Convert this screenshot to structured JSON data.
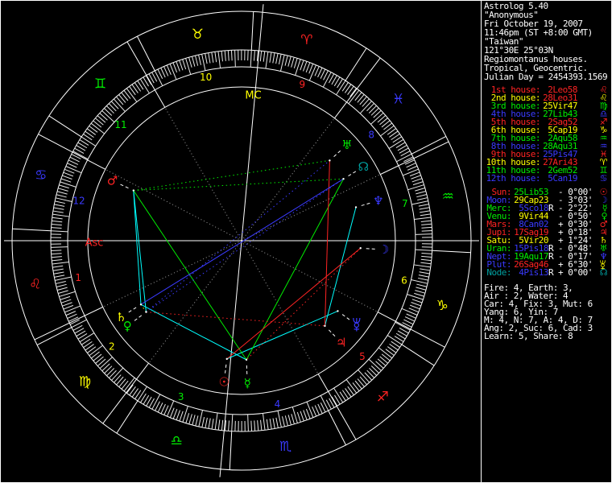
{
  "palette": {
    "red": "#ff2323",
    "yellow": "#ffff00",
    "green": "#00ee00",
    "blue": "#3a3aff",
    "cyan": "#00ffff",
    "dkcyan": "#00a0a0",
    "white": "#ffffff",
    "grey": "#9e9e9e"
  },
  "header": {
    "lines": [
      "Astrolog 5.40",
      "\"Anonymous\"",
      "Fri October 19, 2007",
      "11:46pm (ST +8:00 GMT)",
      "\"Taiwan\"",
      "121°30E 25°03N",
      "Regiomontanus houses.",
      "Tropical, Geocentric.",
      "Julian Day = 2454393.1569"
    ]
  },
  "houses": [
    {
      "label": "1st house:",
      "value": "2Leo58",
      "sign_glyph": "♌",
      "label_color": "red",
      "value_color": "red",
      "glyph_color": "red",
      "cusp": 122.967
    },
    {
      "label": "2nd house:",
      "value": "28Leo31",
      "sign_glyph": "♌",
      "label_color": "yellow",
      "value_color": "red",
      "glyph_color": "yellow",
      "cusp": 148.517
    },
    {
      "label": "3rd house:",
      "value": "25Vir47",
      "sign_glyph": "♍",
      "label_color": "green",
      "value_color": "yellow",
      "glyph_color": "green",
      "cusp": 175.783
    },
    {
      "label": "4th house:",
      "value": "27Lib43",
      "sign_glyph": "♎",
      "label_color": "blue",
      "value_color": "green",
      "glyph_color": "blue",
      "cusp": 207.717
    },
    {
      "label": "5th house:",
      "value": "2Sag52",
      "sign_glyph": "♐",
      "label_color": "red",
      "value_color": "red",
      "glyph_color": "red",
      "cusp": 242.867
    },
    {
      "label": "6th house:",
      "value": "5Cap19",
      "sign_glyph": "♑",
      "label_color": "yellow",
      "value_color": "yellow",
      "glyph_color": "yellow",
      "cusp": 275.317
    },
    {
      "label": "7th house:",
      "value": "2Aqu58",
      "sign_glyph": "♒",
      "label_color": "green",
      "value_color": "green",
      "glyph_color": "green",
      "cusp": 302.967
    },
    {
      "label": "8th house:",
      "value": "28Aqu31",
      "sign_glyph": "♒",
      "label_color": "blue",
      "value_color": "green",
      "glyph_color": "blue",
      "cusp": 328.517
    },
    {
      "label": "9th house:",
      "value": "25Pis47",
      "sign_glyph": "♓",
      "label_color": "red",
      "value_color": "blue",
      "glyph_color": "red",
      "cusp": 355.783
    },
    {
      "label": "10th house:",
      "value": "27Ari43",
      "sign_glyph": "♈",
      "label_color": "yellow",
      "value_color": "red",
      "glyph_color": "yellow",
      "cusp": 27.717
    },
    {
      "label": "11th house:",
      "value": "2Gem52",
      "sign_glyph": "♊",
      "label_color": "green",
      "value_color": "green",
      "glyph_color": "green",
      "cusp": 62.867
    },
    {
      "label": "12th house:",
      "value": "5Can19",
      "sign_glyph": "♋",
      "label_color": "blue",
      "value_color": "blue",
      "glyph_color": "blue",
      "cusp": 95.317
    }
  ],
  "planets": [
    {
      "name": "sun",
      "label": "Sun:",
      "value": "25Lib53",
      "retro": false,
      "delta": "- 0°00'",
      "glyph": "☉",
      "lon": 205.883,
      "label_color": "red",
      "value_color": "green",
      "glyph_color": "red",
      "wheel_color": "red"
    },
    {
      "name": "moon",
      "label": "Moon:",
      "value": "29Cap23",
      "retro": false,
      "delta": "- 3°03'",
      "glyph": "☽",
      "lon": 299.383,
      "label_color": "blue",
      "value_color": "yellow",
      "glyph_color": "blue",
      "wheel_color": "blue"
    },
    {
      "name": "mercury",
      "label": "Merc:",
      "value": "5Sco18",
      "retro": true,
      "delta": "- 2°22'",
      "glyph": "☿",
      "lon": 215.3,
      "label_color": "green",
      "value_color": "blue",
      "glyph_color": "green",
      "wheel_color": "green"
    },
    {
      "name": "venus",
      "label": "Venu:",
      "value": "9Vir44",
      "retro": false,
      "delta": "- 0°50'",
      "glyph": "♀",
      "lon": 159.733,
      "label_color": "green",
      "value_color": "yellow",
      "glyph_color": "green",
      "wheel_color": "green"
    },
    {
      "name": "mars",
      "label": "Mars:",
      "value": "8Can02",
      "retro": false,
      "delta": "+ 0°30'",
      "glyph": "♂",
      "lon": 98.033,
      "label_color": "red",
      "value_color": "blue",
      "glyph_color": "red",
      "wheel_color": "red"
    },
    {
      "name": "jupiter",
      "label": "Jupi:",
      "value": "17Sag19",
      "retro": false,
      "delta": "+ 0°18'",
      "glyph": "♃",
      "lon": 257.317,
      "label_color": "red",
      "value_color": "red",
      "glyph_color": "red",
      "wheel_color": "red"
    },
    {
      "name": "saturn",
      "label": "Satu:",
      "value": "5Vir20",
      "retro": false,
      "delta": "+ 1°24'",
      "glyph": "♄",
      "lon": 155.333,
      "label_color": "yellow",
      "value_color": "yellow",
      "glyph_color": "yellow",
      "wheel_color": "yellow"
    },
    {
      "name": "uranus",
      "label": "Uran:",
      "value": "15Pis18",
      "retro": true,
      "delta": "- 0°48'",
      "glyph": "♅",
      "lon": 345.3,
      "label_color": "green",
      "value_color": "blue",
      "glyph_color": "green",
      "wheel_color": "green"
    },
    {
      "name": "neptune",
      "label": "Nept:",
      "value": "19Aqu17",
      "retro": true,
      "delta": "- 0°17'",
      "glyph": "♆",
      "lon": 319.283,
      "label_color": "blue",
      "value_color": "green",
      "glyph_color": "blue",
      "wheel_color": "blue"
    },
    {
      "name": "pluto",
      "label": "Plut:",
      "value": "26Sag46",
      "retro": false,
      "delta": "+ 6°30'",
      "glyph": "pluto",
      "lon": 266.767,
      "label_color": "blue",
      "value_color": "red",
      "glyph_color": "yellow",
      "wheel_color": "blue"
    },
    {
      "name": "node",
      "label": "Node:",
      "value": "4Pis13",
      "retro": true,
      "delta": "+ 0°00'",
      "glyph": "☊",
      "lon": 334.217,
      "label_color": "dkcyan",
      "value_color": "blue",
      "glyph_color": "dkcyan",
      "wheel_color": "dkcyan"
    }
  ],
  "stats": [
    "Fire: 4, Earth: 3,",
    "Air : 2, Water: 4",
    "Car: 4, Fix: 3, Mut: 6",
    "Yang: 6, Yin: 7",
    "M: 4, N: 7, A: 4, D: 7",
    "Ang: 2, Suc: 6, Cad: 3",
    "Learn: 5, Share: 8"
  ],
  "chart": {
    "asc": 122.967,
    "mc": 27.717,
    "asc_label": {
      "text": "Asc",
      "color": "red"
    },
    "mc_label": {
      "text": "MC",
      "color": "yellow"
    },
    "signs": [
      {
        "name": "aries",
        "glyph": "♈",
        "color": "red"
      },
      {
        "name": "taurus",
        "glyph": "♉",
        "color": "yellow"
      },
      {
        "name": "gemini",
        "glyph": "♊",
        "color": "green"
      },
      {
        "name": "cancer",
        "glyph": "♋",
        "color": "blue"
      },
      {
        "name": "leo",
        "glyph": "♌",
        "color": "red"
      },
      {
        "name": "virgo",
        "glyph": "♍",
        "color": "yellow"
      },
      {
        "name": "libra",
        "glyph": "♎",
        "color": "green"
      },
      {
        "name": "scorpio",
        "glyph": "♏",
        "color": "blue"
      },
      {
        "name": "sagittarius",
        "glyph": "♐",
        "color": "red"
      },
      {
        "name": "capricorn",
        "glyph": "♑",
        "color": "yellow"
      },
      {
        "name": "aquarius",
        "glyph": "♒",
        "color": "green"
      },
      {
        "name": "pisces",
        "glyph": "♓",
        "color": "blue"
      }
    ],
    "house_number_colors": [
      "red",
      "yellow",
      "green",
      "blue",
      "red",
      "yellow",
      "green",
      "blue",
      "red",
      "yellow",
      "green",
      "blue"
    ],
    "aspect_colors": {
      "conjunction": "yellow",
      "sextile": "cyan",
      "square": "red",
      "trine": "green",
      "opposition": "blue"
    },
    "aspects": [
      {
        "a": 2,
        "b": 6,
        "type": "sextile",
        "solid": true
      },
      {
        "a": 0,
        "b": 9,
        "type": "sextile",
        "solid": true
      },
      {
        "a": 3,
        "b": 4,
        "type": "sextile",
        "solid": true
      },
      {
        "a": 5,
        "b": 8,
        "type": "sextile",
        "solid": true
      },
      {
        "a": 4,
        "b": 6,
        "type": "sextile",
        "solid": true
      },
      {
        "a": 2,
        "b": 10,
        "type": "trine",
        "solid": true
      },
      {
        "a": 2,
        "b": 4,
        "type": "trine",
        "solid": true
      },
      {
        "a": 5,
        "b": 7,
        "type": "square",
        "solid": true
      },
      {
        "a": 0,
        "b": 1,
        "type": "square",
        "solid": true
      },
      {
        "a": 6,
        "b": 10,
        "type": "opposition",
        "solid": true
      },
      {
        "a": 4,
        "b": 10,
        "type": "trine",
        "solid": false
      },
      {
        "a": 4,
        "b": 7,
        "type": "trine",
        "solid": false
      },
      {
        "a": 1,
        "b": 2,
        "type": "square",
        "solid": false
      },
      {
        "a": 3,
        "b": 5,
        "type": "square",
        "solid": false
      },
      {
        "a": 3,
        "b": 7,
        "type": "opposition",
        "solid": false
      },
      {
        "a": 3,
        "b": 10,
        "type": "opposition",
        "solid": false
      },
      {
        "a": 3,
        "b": 6,
        "type": "conjunction",
        "solid": false
      }
    ]
  }
}
